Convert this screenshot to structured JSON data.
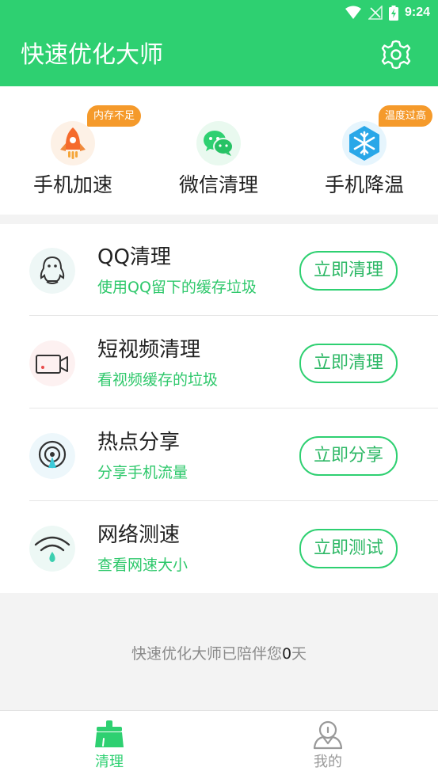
{
  "status_bar": {
    "time": "9:24"
  },
  "header": {
    "title": "快速优化大师"
  },
  "quick_actions": [
    {
      "label": "手机加速",
      "badge": "内存不足",
      "icon": "rocket-icon"
    },
    {
      "label": "微信清理",
      "badge": "",
      "icon": "wechat-icon"
    },
    {
      "label": "手机降温",
      "badge": "温度过高",
      "icon": "snowflake-icon"
    }
  ],
  "list": [
    {
      "title": "QQ清理",
      "subtitle": "使用QQ留下的缓存垃圾",
      "button": "立即清理",
      "icon": "qq-penguin-icon"
    },
    {
      "title": "短视频清理",
      "subtitle": "看视频缓存的垃圾",
      "button": "立即清理",
      "icon": "video-camera-icon"
    },
    {
      "title": "热点分享",
      "subtitle": "分享手机流量",
      "button": "立即分享",
      "icon": "hotspot-icon"
    },
    {
      "title": "网络测速",
      "subtitle": "查看网速大小",
      "button": "立即测试",
      "icon": "wifi-icon"
    }
  ],
  "footer": {
    "text_prefix": "快速优化大师已陪伴您",
    "days": "0",
    "text_suffix": "天"
  },
  "tabs": [
    {
      "label": "清理",
      "active": true,
      "icon": "broom-icon"
    },
    {
      "label": "我的",
      "active": false,
      "icon": "user-icon"
    }
  ],
  "colors": {
    "brand": "#2ed071",
    "badge": "#f59a2b",
    "active_tab": "#2ed071",
    "inactive_tab": "#999999"
  }
}
